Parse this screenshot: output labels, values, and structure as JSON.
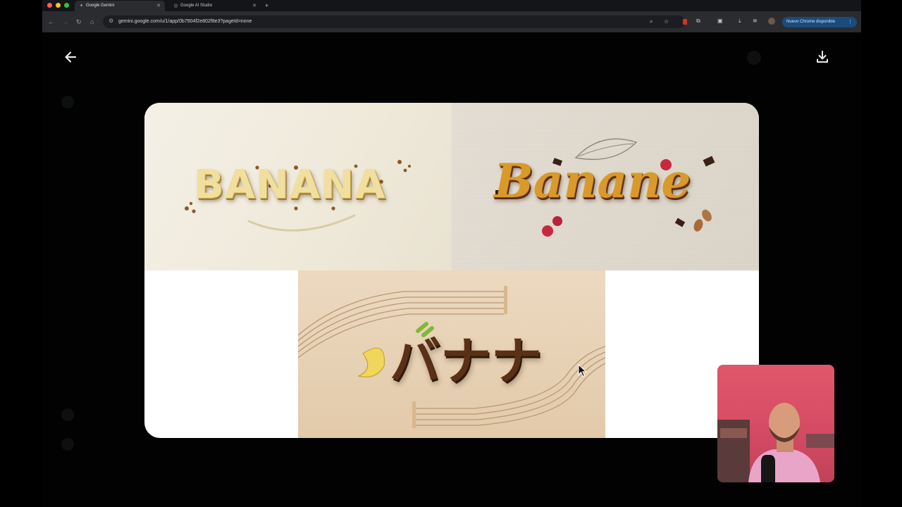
{
  "browser": {
    "tabs": [
      {
        "title": "Google Gemini",
        "active": true
      },
      {
        "title": "Google AI Studio",
        "active": false
      }
    ],
    "new_tab_symbol": "+",
    "url": "gemini.google.com/u/1/app/0b7904f2e802f8e3?pageId=none",
    "update_label": "Nuevo Chrome disponible",
    "kebab": "⋮"
  },
  "viewer": {
    "back_icon": "arrow-left-icon",
    "download_icon": "download-icon",
    "images": [
      {
        "caption_text": "BANANA"
      },
      {
        "caption_text": "Banane"
      },
      {
        "caption_text": "バナナ"
      }
    ]
  },
  "colors": {
    "page_bg": "#000000",
    "chrome_bg": "#2b2c30",
    "tabstrip_bg": "#141518",
    "update_pill_bg": "#1a4b7c",
    "card_bg": "#ffffff"
  }
}
